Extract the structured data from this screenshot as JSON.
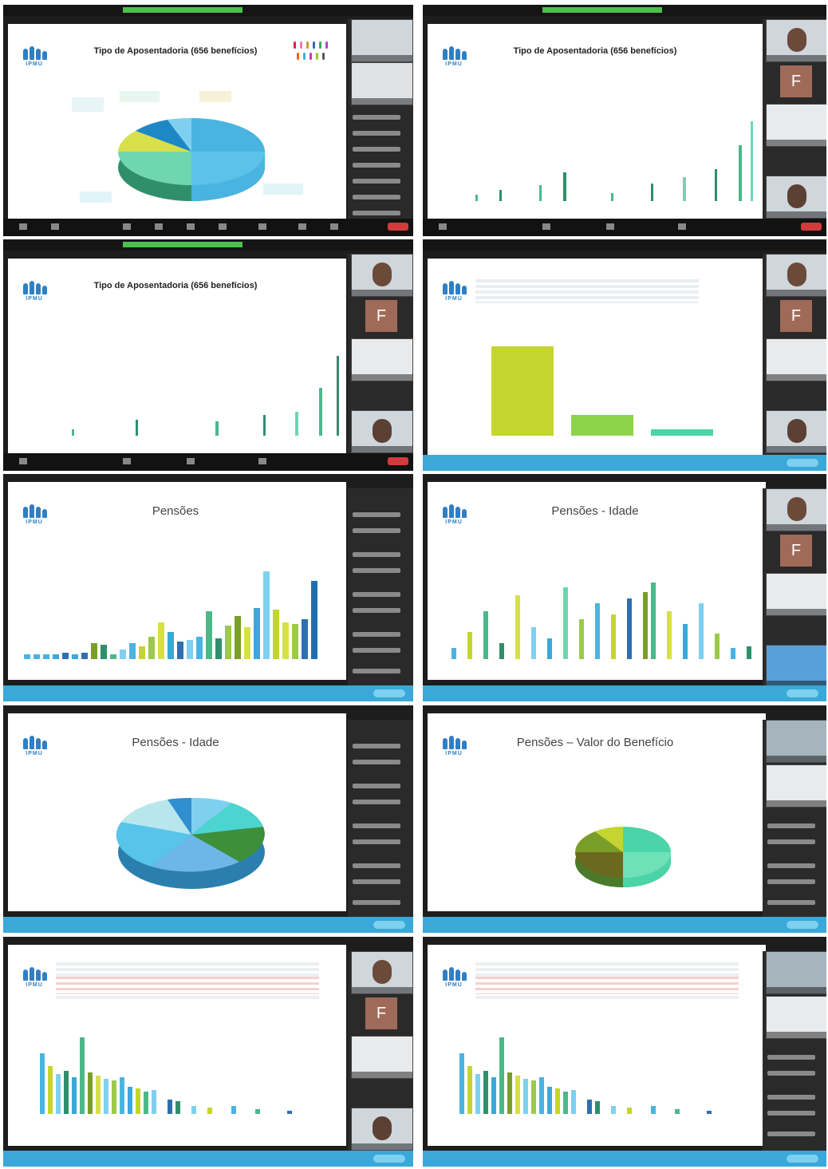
{
  "titles": {
    "t1": "Tipo de Aposentadoria (656 benefícios)",
    "t2": "Tipo de Aposentadoria (656 benefícios)",
    "t3": "Tipo de Aposentadoria (656 benefícios)",
    "t5": "Pensões",
    "t6": "Pensões - Idade",
    "t7": "Pensões - Idade",
    "t8": "Pensões – Valor do Benefício"
  },
  "logo": "IPMU",
  "tile_letter": "F",
  "colors": {
    "blue": "#3aa8d8",
    "green": "#4ec04e",
    "lime": "#c5d52f",
    "navy": "#2f6fb0",
    "teal": "#4bb88a"
  }
}
